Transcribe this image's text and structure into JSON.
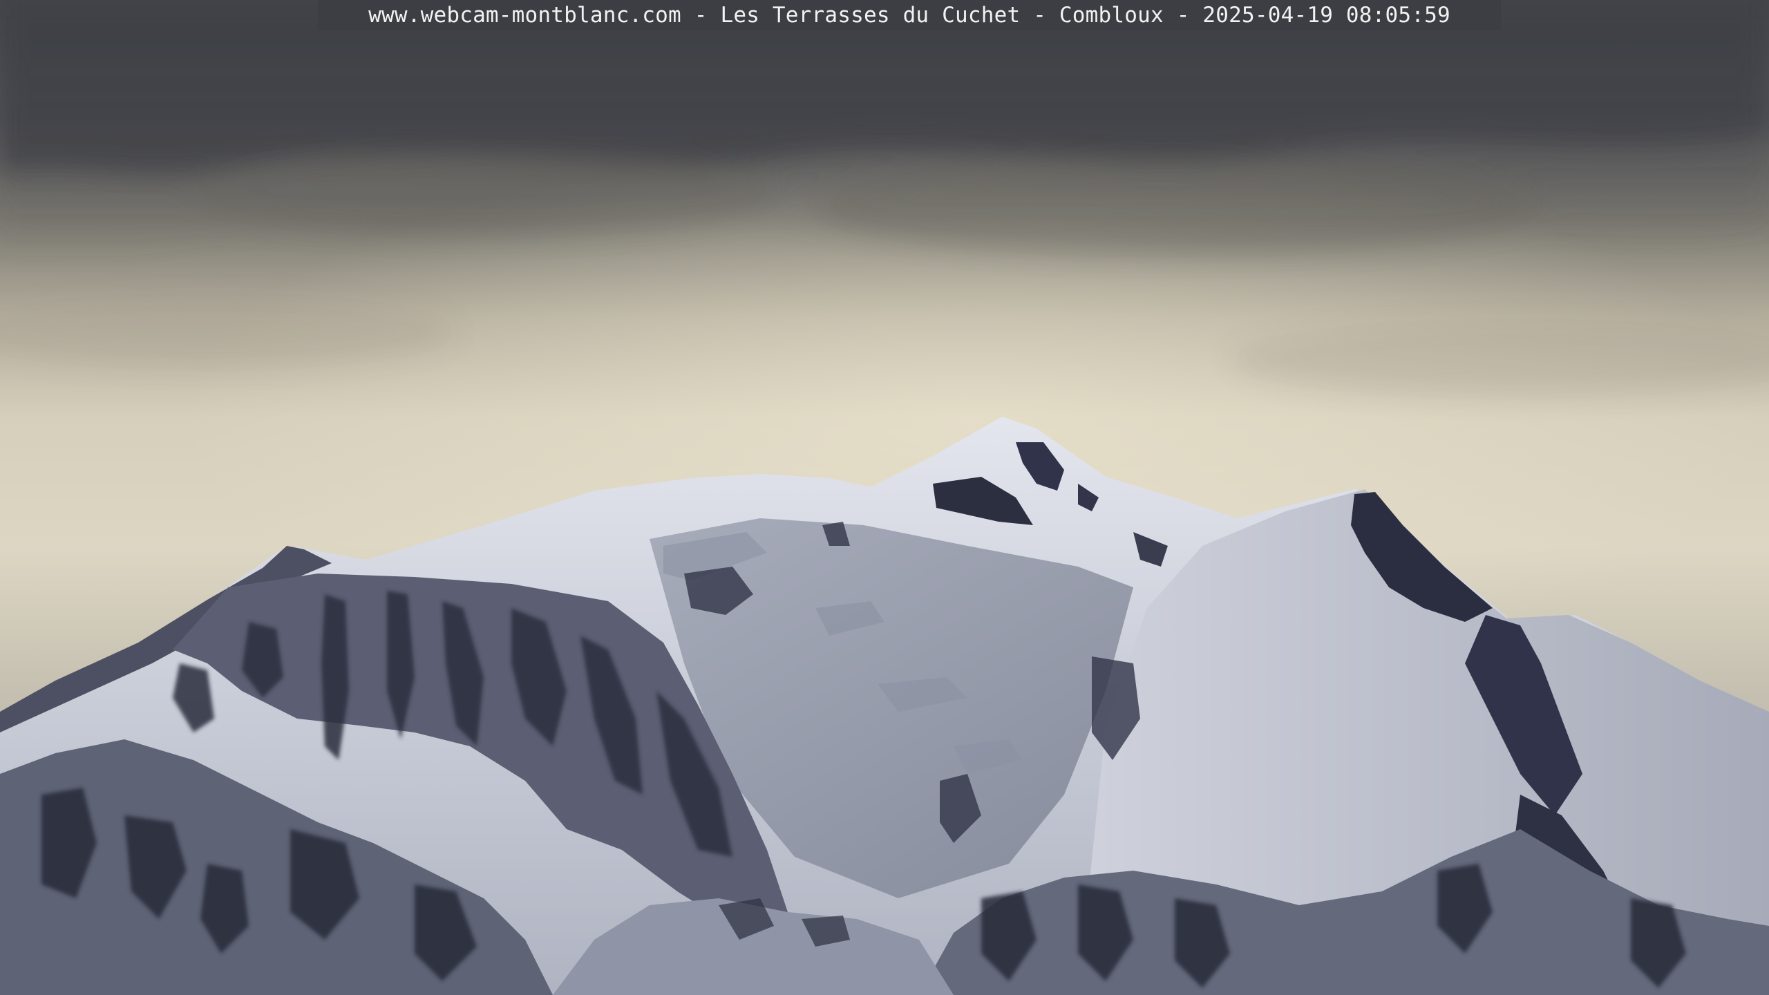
{
  "overlay": {
    "caption": "www.webcam-montblanc.com - Les Terrasses du Cuchet - Combloux - 2025-04-19 08:05:59"
  },
  "scene": {
    "subject": "mountain-icon",
    "colors": {
      "sky_top": "#4a4b50",
      "sky_mid": "#8e8a80",
      "sky_glow": "#ddd7c4",
      "sky_horizon": "#c9c3b0",
      "snow_light": "#d8dbe4",
      "snow_mid": "#a9adba",
      "snow_shadow": "#7c8090",
      "rock_dark": "#2a2d3c"
    }
  }
}
